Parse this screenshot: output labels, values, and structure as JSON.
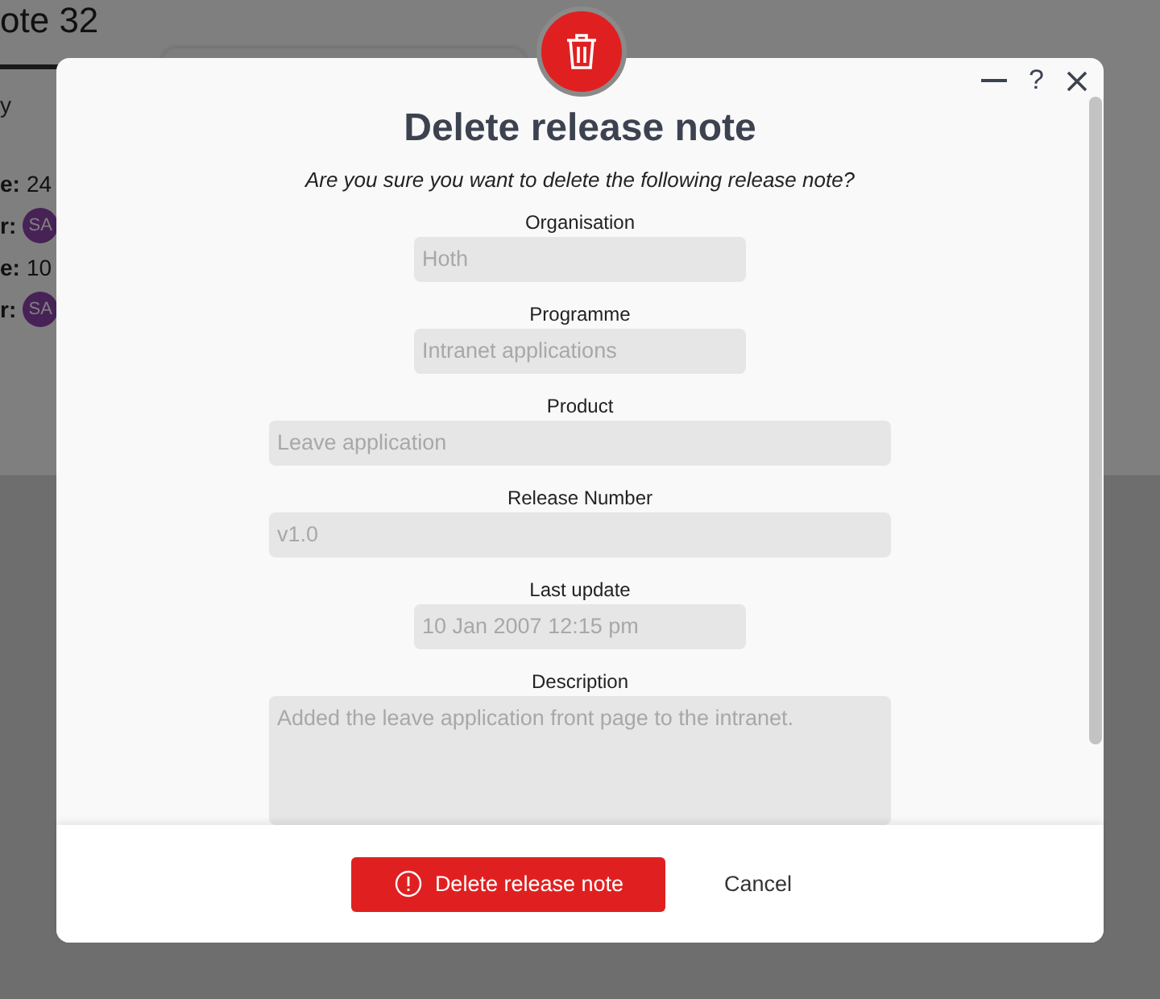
{
  "background": {
    "title": "ote 32",
    "tab": "y",
    "meta": [
      {
        "label": "e:",
        "value": "24"
      },
      {
        "label": "r:",
        "avatar": "SA"
      },
      {
        "label": "e:",
        "value": "10"
      },
      {
        "label": "r:",
        "avatar": "SA"
      }
    ]
  },
  "dialog": {
    "help": "?",
    "title": "Delete release note",
    "question": "Are you sure you want to delete the following release note?",
    "fields": [
      {
        "label": "Organisation",
        "value": "Hoth",
        "kind": "short",
        "disabled": true
      },
      {
        "label": "Programme",
        "value": "Intranet applications",
        "kind": "short",
        "disabled": true
      },
      {
        "label": "Product",
        "value": "Leave application",
        "kind": "wide",
        "disabled": true
      },
      {
        "label": "Release Number",
        "value": "v1.0",
        "kind": "wide",
        "disabled": true
      },
      {
        "label": "Last update",
        "value": "10 Jan 2007 12:15 pm",
        "kind": "short",
        "disabled": true
      },
      {
        "label": "Description",
        "value": "Added the leave application front page to the intranet.",
        "kind": "textarea",
        "disabled": true
      }
    ],
    "primary_button": "Delete release note",
    "cancel_button": "Cancel"
  }
}
